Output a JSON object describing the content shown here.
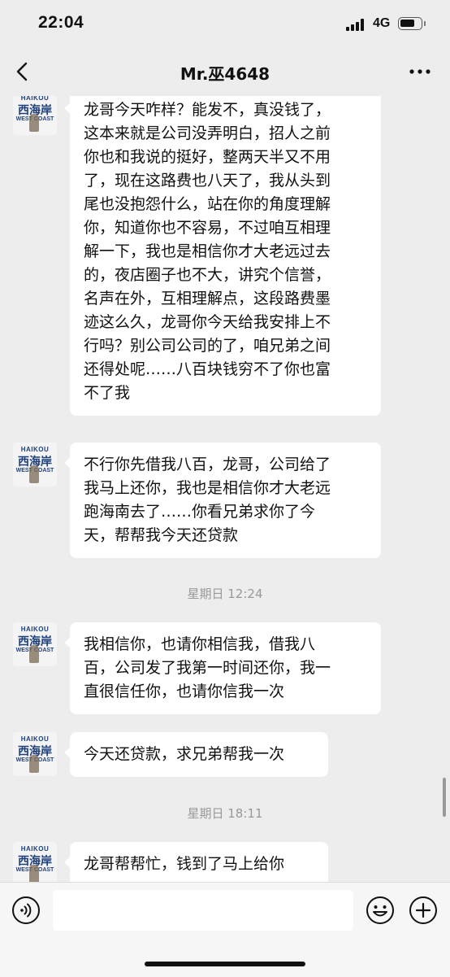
{
  "status_bar": {
    "time": "22:04",
    "network": "4G",
    "battery_level": 0.75
  },
  "nav": {
    "title": "Mr.巫4648"
  },
  "avatar": {
    "top_text": "HAIKOU",
    "mid_text": "西海岸",
    "bottom_text": "WEST COAST"
  },
  "messages": [
    {
      "type": "text",
      "text": "龙哥今天咋样？能发不，真没钱了，\n这本来就是公司没弄明白，招人之前\n你也和我说的挺好，整两天半又不用\n了，现在这路费也八天了，我从头到\n尾也没抱怨什么，站在你的角度理解\n你，知道你也不容易，不过咱互相理\n解一下，我也是相信你才大老远过去\n的，夜店圈子也不大，讲究个信誉，\n名声在外，互相理解点，这段路费墨\n迹这么久，龙哥你今天给我安排上不\n行吗？别公司公司的了，咱兄弟之间\n还得处呢……八百块钱穷不了你也富\n不了我"
    },
    {
      "type": "text",
      "text": "不行你先借我八百，龙哥，公司给了\n我马上还你，我也是相信你才大老远\n跑海南去了……你看兄弟求你了今\n天，帮帮我今天还贷款"
    },
    {
      "type": "time",
      "text": "星期日 12:24"
    },
    {
      "type": "text",
      "text": "我相信你，也请你相信我，借我八\n百，公司发了我第一时间还你，我一\n直很信任你，也请你信我一次"
    },
    {
      "type": "text",
      "text": "今天还贷款，求兄弟帮我一次"
    },
    {
      "type": "time",
      "text": "星期日 18:11"
    },
    {
      "type": "text",
      "text": "龙哥帮帮忙，钱到了马上给你"
    }
  ],
  "input": {
    "placeholder": ""
  },
  "icons": {
    "back": "chevron-left-icon",
    "more": "more-dots-icon",
    "voice": "voice-icon",
    "emoji": "emoji-icon",
    "plus": "plus-icon"
  }
}
